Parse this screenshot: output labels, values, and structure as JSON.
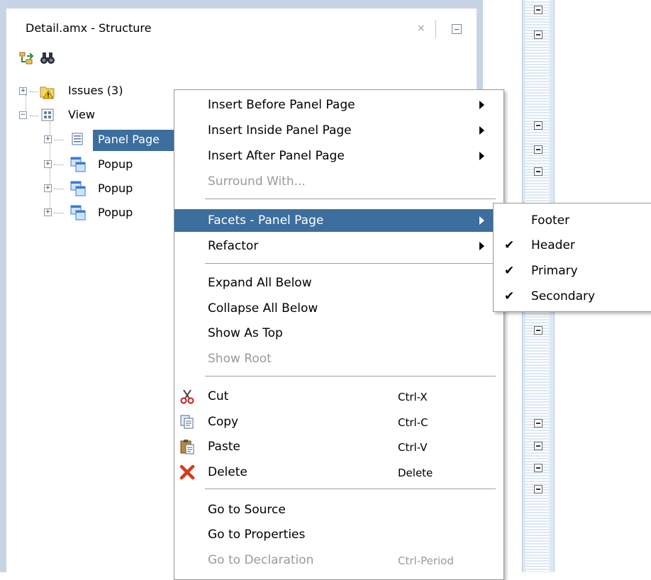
{
  "panel": {
    "title": "Detail.amx - Structure",
    "close_glyph": "×",
    "toolbar": [
      {
        "icon": "synchronize-icon"
      },
      {
        "icon": "binoculars-find-icon"
      }
    ]
  },
  "tree": {
    "nodes": [
      {
        "label": "Issues (3)",
        "icon": "folder-warning-icon",
        "expander": "+"
      },
      {
        "label": "View",
        "icon": "view-grid-icon",
        "expander": "−"
      },
      {
        "label": "Panel Page",
        "icon": "panel-page-icon",
        "expander": "+",
        "selected": true
      },
      {
        "label": "Popup",
        "icon": "popup-icon",
        "expander": "+"
      },
      {
        "label": "Popup",
        "icon": "popup-icon",
        "expander": "+"
      },
      {
        "label": "Popup",
        "icon": "popup-icon",
        "expander": "+"
      }
    ]
  },
  "menu": {
    "items": [
      {
        "label": "Insert Before Panel Page",
        "submenu": true
      },
      {
        "label": "Insert Inside Panel Page",
        "submenu": true
      },
      {
        "label": "Insert After Panel Page",
        "submenu": true
      },
      {
        "label": "Surround With...",
        "disabled": true
      },
      {
        "label": "Facets - Panel Page",
        "submenu": true,
        "highlighted": true
      },
      {
        "label": "Refactor",
        "submenu": true
      },
      {
        "label": "Expand All Below"
      },
      {
        "label": "Collapse All Below"
      },
      {
        "label": "Show As Top"
      },
      {
        "label": "Show Root",
        "disabled": true
      },
      {
        "label": "Cut",
        "shortcut": "Ctrl-X",
        "icon": "scissors-icon"
      },
      {
        "label": "Copy",
        "shortcut": "Ctrl-C",
        "icon": "copy-icon"
      },
      {
        "label": "Paste",
        "shortcut": "Ctrl-V",
        "icon": "paste-icon"
      },
      {
        "label": "Delete",
        "shortcut": "Delete",
        "icon": "delete-x-icon"
      },
      {
        "label": "Go to Source"
      },
      {
        "label": "Go to Properties"
      },
      {
        "label": "Go to Declaration",
        "shortcut": "Ctrl-Period",
        "disabled": true
      }
    ]
  },
  "submenu": {
    "items": [
      {
        "label": "Footer",
        "checked": false
      },
      {
        "label": "Header",
        "checked": true
      },
      {
        "label": "Primary",
        "checked": true
      },
      {
        "label": "Secondary",
        "checked": true
      }
    ],
    "check_glyph": "✔"
  },
  "colors": {
    "highlight": "#3c6e9e",
    "panel_border": "#c6d4e6",
    "disabled_text": "#9a9a9a"
  }
}
